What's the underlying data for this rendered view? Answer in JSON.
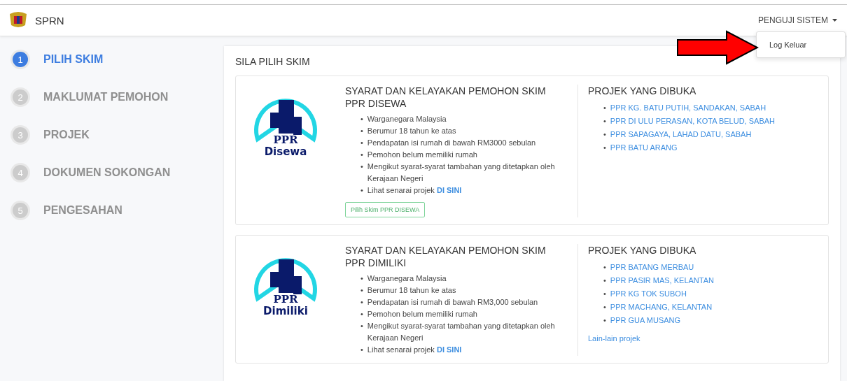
{
  "navbar": {
    "brand": "SPRN",
    "user_menu": "PENGUJI SISTEM",
    "dropdown": [
      "Log Keluar"
    ]
  },
  "steps": [
    {
      "number": "1",
      "label": "PILIH SKIM",
      "selected": true
    },
    {
      "number": "2",
      "label": "MAKLUMAT PEMOHON",
      "selected": false
    },
    {
      "number": "3",
      "label": "PROJEK",
      "selected": false
    },
    {
      "number": "4",
      "label": "DOKUMEN SOKONGAN",
      "selected": false
    },
    {
      "number": "5",
      "label": "PENGESAHAN",
      "selected": false
    }
  ],
  "panel": {
    "heading": "SILA PILIH SKIM",
    "bullet": "•"
  },
  "schemes": [
    {
      "logo_line1": "PPR",
      "logo_line2": "Disewa",
      "title": "SYARAT DAN KELAYAKAN PEMOHON SKIM PPR DISEWA",
      "requirements": [
        "Warganegara Malaysia",
        "Berumur 18 tahun ke atas",
        "Pendapatan isi rumah di bawah RM3000 sebulan",
        "Pemohon belum memiliki rumah",
        "Mengikut syarat-syarat tambahan yang ditetapkan oleh Kerajaan Negeri"
      ],
      "see_list": "Lihat senarai projek",
      "see_link": "DI SINI",
      "button": "Pilih Skim PPR DISEWA",
      "projects_heading": "PROJEK YANG DIBUKA",
      "projects": [
        "PPR KG. BATU PUTIH, SANDAKAN, SABAH",
        "PPR DI ULU PERASAN, KOTA BELUD, SABAH",
        "PPR SAPAGAYA, LAHAD DATU, SABAH",
        "PPR BATU ARANG"
      ]
    },
    {
      "logo_line1": "PPR",
      "logo_line2": "Dimiliki",
      "title": "SYARAT DAN KELAYAKAN PEMOHON SKIM PPR DIMILIKI",
      "requirements": [
        "Warganegara Malaysia",
        "Berumur 18 tahun ke atas",
        "Pendapatan isi rumah di bawah RM3,000 sebulan",
        "Pemohon belum memiliki rumah",
        "Mengikut syarat-syarat tambahan yang ditetapkan oleh Kerajaan Negeri"
      ],
      "see_list": "Lihat senarai projek",
      "see_link": "DI SINI",
      "projects_heading": "PROJEK YANG DIBUKA",
      "projects": [
        "PPR BATANG MERBAU",
        "PPR PASIR MAS, KELANTAN",
        "PPR KG TOK SUBOH",
        "PPR MACHANG, KELANTAN",
        "PPR GUA MUSANG"
      ],
      "more_link": "Lain-lain projek"
    }
  ]
}
